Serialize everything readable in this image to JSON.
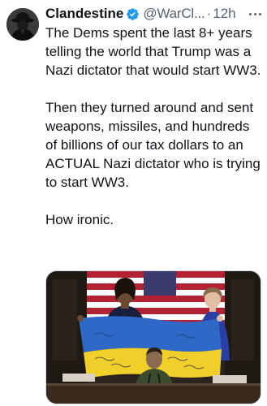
{
  "tweet": {
    "author_name": "Clandestine",
    "handle": "@WarCl...",
    "separator": "·",
    "time": "12h",
    "verified": true,
    "paragraphs": [
      "The Dems spent the last 8+ years telling the world that Trump was a Nazi dictator that would start WW3.",
      "Then they turned around and sent weapons, missiles, and hundreds of billions of our tax dollars to an ACTUAL Nazi dictator who is trying to start WW3.",
      "How ironic."
    ],
    "icons": {
      "verified": "verified-badge-icon",
      "more": "more-options-icon"
    },
    "colors": {
      "verified_blue": "#1d9bf0",
      "secondary_text": "#536471",
      "primary_text": "#0f1419"
    }
  }
}
